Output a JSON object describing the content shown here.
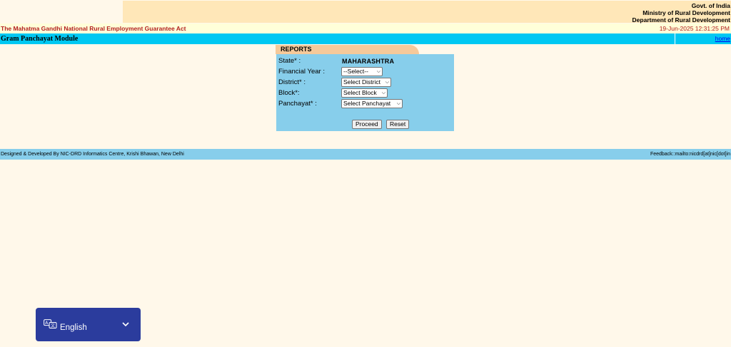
{
  "header": {
    "gov_lines": [
      "Govt. of India",
      "Ministry of Rural Development",
      "Department of Rural Development"
    ],
    "act_title": "The Mahatma Gandhi National Rural Employment Guarantee Act",
    "timestamp": "19-Jun-2025 12:31:25 PM"
  },
  "module_bar": {
    "title": "Gram Panchayat Module",
    "home_link": "home"
  },
  "form": {
    "tab_title": "REPORTS",
    "fields": [
      {
        "label": "State* :",
        "value": "MAHARASHTRA"
      },
      {
        "label": "Financial Year :",
        "selected": "--Select--"
      },
      {
        "label": "District* :",
        "selected": "Select District"
      },
      {
        "label": "Block*:",
        "selected": "Select Block"
      },
      {
        "label": "Panchayat* :",
        "selected": "Select Panchayat"
      }
    ],
    "buttons": {
      "proceed": "Proceed",
      "reset": "Reset"
    }
  },
  "footer": {
    "left": "Designed & Developed By NIC-DRD Informatics Centre, Krishi Bhawan, New Delhi",
    "right": "Feedback::mailto:nicdrd[at]nic[dot]in"
  },
  "language_widget": {
    "label": "English",
    "icon": "translate-icon",
    "chevron": "chevron-down-icon"
  },
  "colors": {
    "header_right_bg": "#ffe7b8",
    "act_title": "#b3201f",
    "module_bar_bg": "#00c8f2",
    "panel_bg": "#87ceeb",
    "tab_bg": "#f5c99a",
    "widget_bg": "#2b3c9d"
  }
}
